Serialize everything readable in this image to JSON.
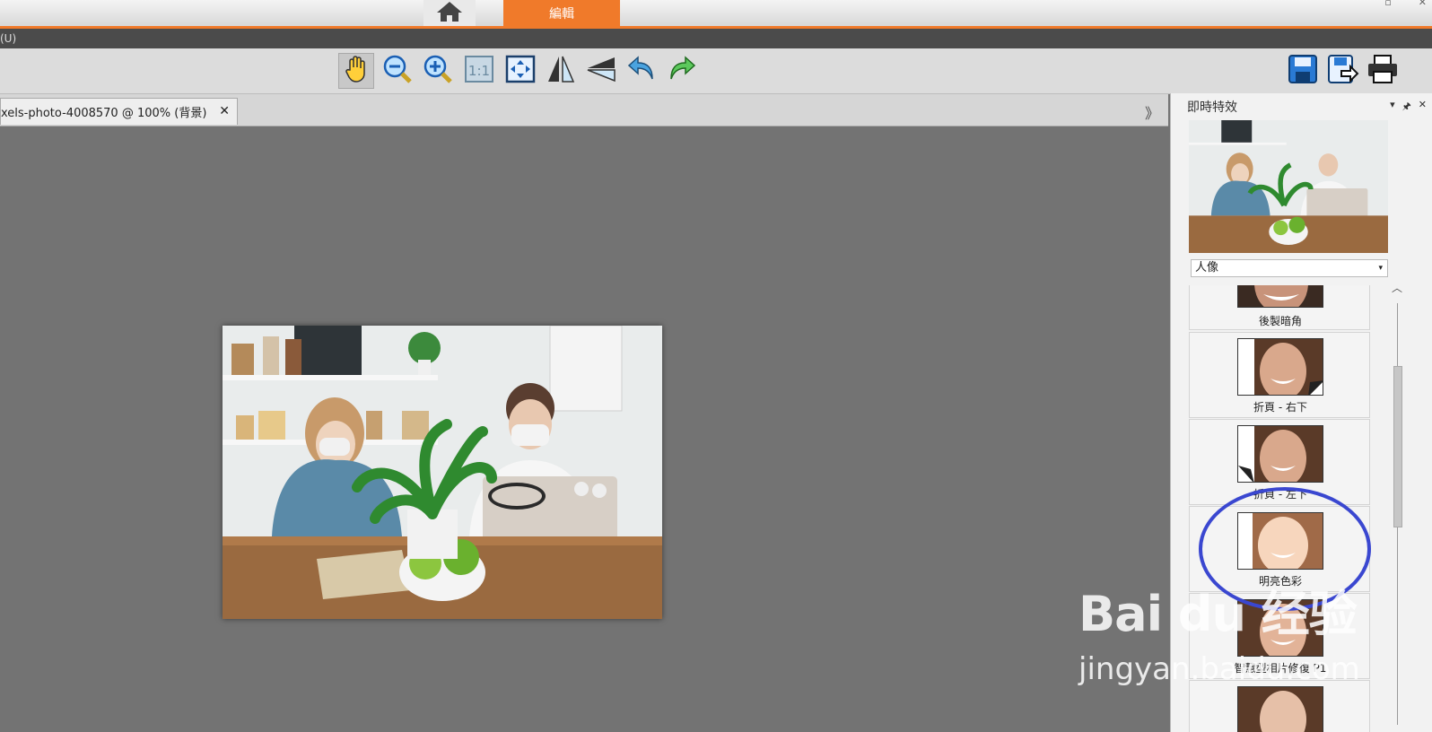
{
  "tabs": {
    "home_icon": "home-icon",
    "edit_label": "編輯"
  },
  "menubar": {
    "text": "(U)"
  },
  "toolbar": {
    "tools": [
      "hand-icon",
      "zoom-out-icon",
      "zoom-in-icon",
      "actual-size-icon",
      "fit-window-icon",
      "flip-horizontal-icon",
      "flip-vertical-icon",
      "rotate-left-icon",
      "rotate-right-icon"
    ],
    "right_tools": [
      "save-icon",
      "save-as-icon",
      "print-icon"
    ]
  },
  "document": {
    "tab_label": "xels-photo-4008570 @ 100% (背景)",
    "close": "✕",
    "scroll_arrow": "》"
  },
  "panel": {
    "title": "即時特效",
    "category": "人像",
    "effects": [
      {
        "label": "後製暗角"
      },
      {
        "label": "折頁 - 右下"
      },
      {
        "label": "折頁 - 左下"
      },
      {
        "label": "明亮色彩"
      },
      {
        "label": "智慧型相片修復 P1"
      },
      {
        "label": ""
      }
    ]
  },
  "watermark": {
    "logo": "Bai du 经验",
    "sub": "jingyan.baidu.com"
  },
  "colors": {
    "accent": "#f07a2a",
    "highlight_circle": "#3a47d0"
  }
}
